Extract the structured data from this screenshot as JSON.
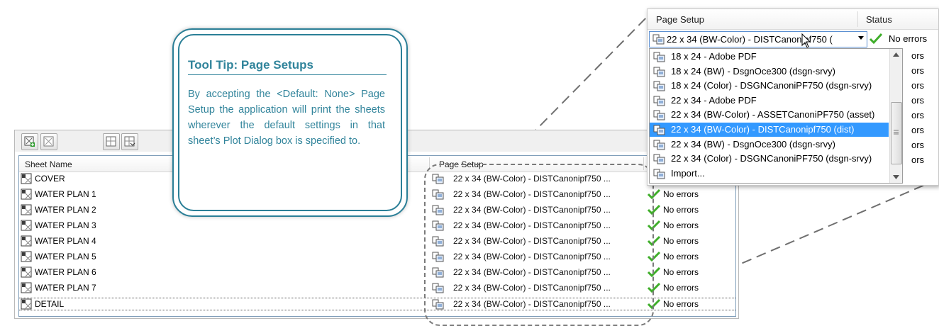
{
  "toolbar": {
    "buttons": [
      "new-sheet-icon",
      "sheet-icon",
      "sheet-grid-icon",
      "sheet-export-icon"
    ]
  },
  "list": {
    "headers": {
      "sheet_name": "Sheet Name",
      "page_setup": "Page Setup"
    },
    "rows": [
      {
        "name": "COVER",
        "page_setup": "22 x 34 (BW-Color) - DISTCanonipf750 ...",
        "status": "No errors"
      },
      {
        "name": "WATER PLAN 1",
        "page_setup": "22 x 34 (BW-Color) - DISTCanonipf750 ...",
        "status": "No errors"
      },
      {
        "name": "WATER PLAN 2",
        "page_setup": "22 x 34 (BW-Color) - DISTCanonipf750 ...",
        "status": "No errors"
      },
      {
        "name": "WATER PLAN 3",
        "page_setup": "22 x 34 (BW-Color) - DISTCanonipf750 ...",
        "status": "No errors"
      },
      {
        "name": "WATER PLAN 4",
        "page_setup": "22 x 34 (BW-Color) - DISTCanonipf750 ...",
        "status": "No errors"
      },
      {
        "name": "WATER PLAN 5",
        "page_setup": "22 x 34 (BW-Color) - DISTCanonipf750 ...",
        "status": "No errors"
      },
      {
        "name": "WATER PLAN 6",
        "page_setup": "22 x 34 (BW-Color) - DISTCanonipf750 ...",
        "status": "No errors"
      },
      {
        "name": "WATER PLAN 7",
        "page_setup": "22 x 34 (BW-Color) - DISTCanonipf750 ...",
        "status": "No errors"
      },
      {
        "name": "DETAIL",
        "page_setup": "22 x 34 (BW-Color) - DISTCanonipf750 ...",
        "status": "No errors"
      }
    ]
  },
  "tooltip": {
    "title": "Tool Tip:  Page Setups",
    "body": "By accepting the <Default: None> Page Setup the application will print the sheets wherever the default settings in that sheet’s Plot Dialog box is specified to."
  },
  "zoom": {
    "headers": {
      "page_setup": "Page Setup",
      "status": "Status"
    },
    "selected_value": "22 x 34 (BW-Color) - DISTCanonipf750 (",
    "selected_status": "No errors",
    "options": [
      "18 x 24 - Adobe PDF",
      "18 x 24 (BW) - DsgnOce300 (dsgn-srvy)",
      "18 x 24 (Color) - DSGNCanoniPF750 (dsgn-srvy)",
      "22 x 34 - Adobe PDF",
      "22 x 34 (BW-Color) - ASSETCanoniPF750 (asset)",
      "22 x 34 (BW-Color) - DISTCanonipf750 (dist)",
      "22 x 34 (BW) - DsgnOce300 (dsgn-srvy)",
      "22 x 34 (Color) - DSGNCanoniPF750 (dsgn-srvy)",
      "Import..."
    ],
    "selected_index": 5,
    "behind_text": [
      "ors",
      "ors",
      "ors",
      "ors",
      "ors",
      "ors",
      "ors",
      "ors"
    ]
  },
  "colors": {
    "accent": "#31849b",
    "check": "#3fae2a",
    "selection": "#3399ff"
  }
}
